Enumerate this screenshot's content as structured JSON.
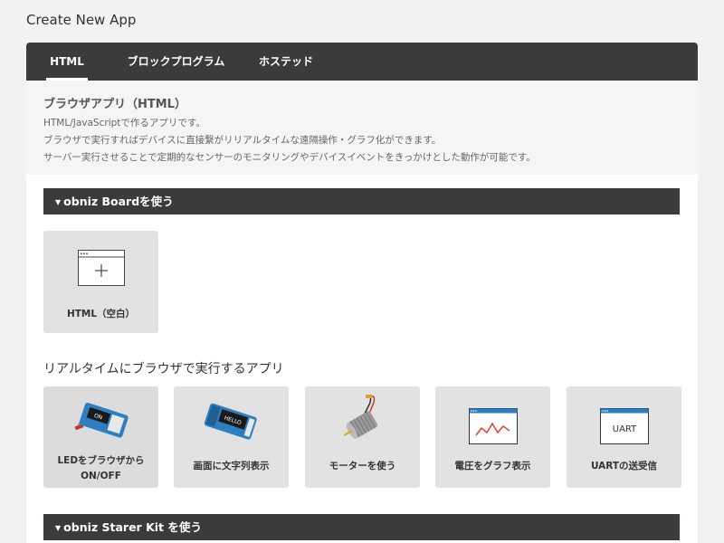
{
  "page": {
    "title": "Create New App"
  },
  "tabs": [
    {
      "label": "HTML",
      "active": true
    },
    {
      "label": "ブロックプログラム",
      "active": false
    },
    {
      "label": "ホステッド",
      "active": false
    }
  ],
  "description": {
    "title": "ブラウザアプリ（HTML）",
    "lines": [
      "HTML/JavaScriptで作るアプリです。",
      "ブラウザで実行すればデバイスに直接繋がリリアルタイムな遠隔操作・グラフ化ができます。",
      "サーバー実行させることで定期的なセンサーのモニタリングやデバイスイベントをきっかけとした動作が可能です。"
    ]
  },
  "sections": {
    "board": {
      "label": "obniz Boardを使う"
    },
    "starter": {
      "label": "obniz Starer Kit を使う"
    }
  },
  "blank_card": {
    "label": "HTML（空白）",
    "icon": "browser-window-plus-icon"
  },
  "realtime": {
    "heading": "リアルタイムにブラウザで実行するアプリ",
    "cards": [
      {
        "label_line1": "LEDをブラウザから",
        "label_line2": "ON/OFF",
        "icon": "obniz-led-board-icon",
        "board_text": "ON"
      },
      {
        "label_line1": "画面に文字列表示",
        "label_line2": "",
        "icon": "obniz-display-board-icon",
        "board_text": "HELLO"
      },
      {
        "label_line1": "モーターを使う",
        "label_line2": "",
        "icon": "motor-icon"
      },
      {
        "label_line1": "電圧をグラフ表示",
        "label_line2": "",
        "icon": "voltage-graph-icon"
      },
      {
        "label_line1": "UARTの送受信",
        "label_line2": "",
        "icon": "uart-window-icon",
        "window_text": "UART"
      }
    ]
  },
  "colors": {
    "dark_bar": "#3d3b39",
    "card_bg": "#e2e2e2",
    "accent_blue": "#2d7fc1",
    "graph_red": "#e8453c"
  }
}
